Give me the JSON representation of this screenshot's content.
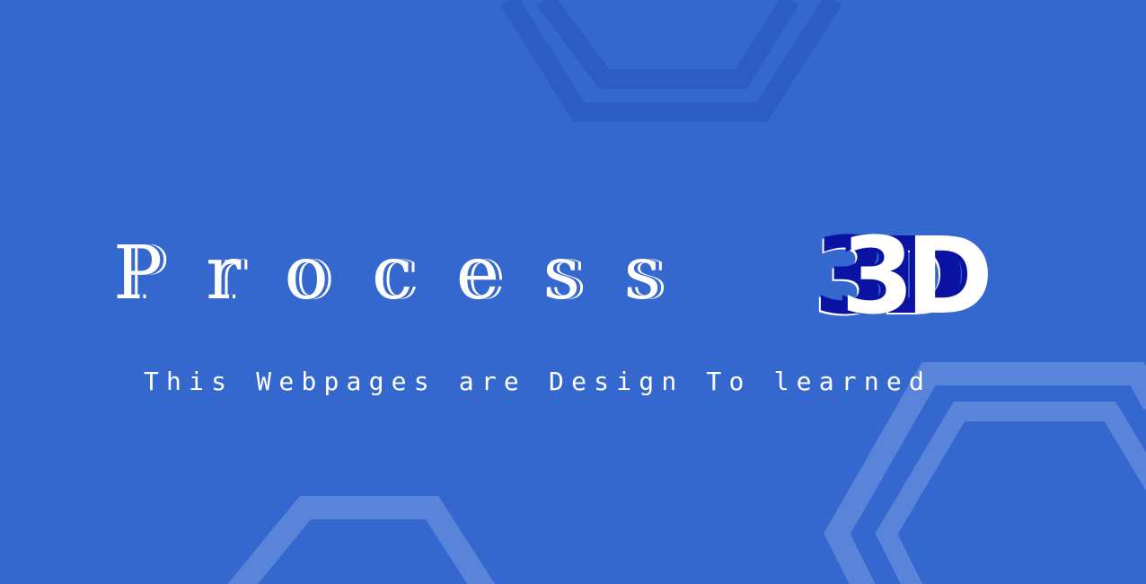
{
  "hero": {
    "title_word": "Process",
    "title_accent": "3D",
    "subtitle": "This Webpages are Design To learned"
  },
  "colors": {
    "background": "#3468cf",
    "accent_dark": "#0a13a2",
    "text": "#ffffff",
    "shape_dark": "#2c5cc4",
    "shape_light": "#5a83da"
  },
  "decorations": [
    {
      "name": "hexagon-shape-top",
      "tone": "dark"
    },
    {
      "name": "hexagon-shape-bottom-left",
      "tone": "light"
    },
    {
      "name": "hexagon-shape-bottom-right",
      "tone": "light"
    }
  ]
}
